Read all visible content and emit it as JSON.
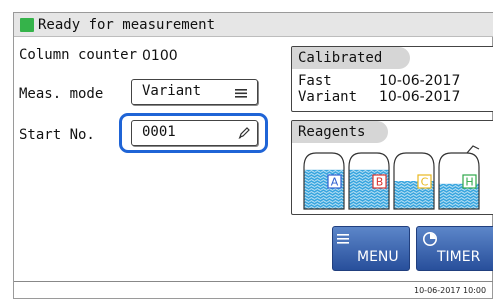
{
  "window": {
    "title": "Ready for measurement"
  },
  "column_counter": {
    "label": "Column counter",
    "value": "0100"
  },
  "meas_mode": {
    "label": "Meas. mode",
    "value": "Variant"
  },
  "start_no": {
    "label": "Start No.",
    "value": "0001"
  },
  "calibrated": {
    "title": "Calibrated",
    "rows": [
      {
        "name": "Fast",
        "date": "10-06-2017"
      },
      {
        "name": "Variant",
        "date": "10-06-2017"
      }
    ]
  },
  "reagents": {
    "title": "Reagents",
    "bottles": [
      {
        "letter": "A",
        "color": "#2f5fd0",
        "fill": 0.7
      },
      {
        "letter": "B",
        "color": "#d8342f",
        "fill": 0.7
      },
      {
        "letter": "C",
        "color": "#e8b820",
        "fill": 0.5
      },
      {
        "letter": "H",
        "color": "#2ea84a",
        "fill": 0.45
      }
    ]
  },
  "buttons": {
    "menu": "MENU",
    "timer": "TIMER"
  },
  "footer": {
    "timestamp": "10-06-2017 10:00"
  },
  "colors": {
    "status": "#35b34a",
    "accent": "#1f64d6",
    "button": "#3a66b4"
  }
}
